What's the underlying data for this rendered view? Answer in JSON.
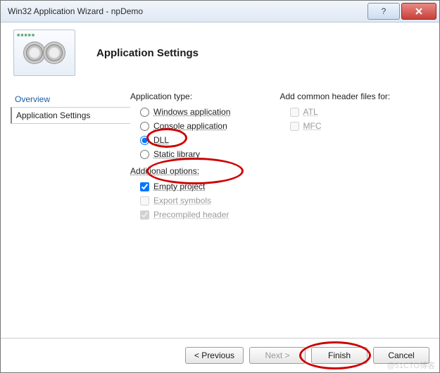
{
  "window": {
    "title": "Win32 Application Wizard - npDemo"
  },
  "header": {
    "title": "Application Settings"
  },
  "sidebar": {
    "items": [
      {
        "label": "Overview",
        "active": false
      },
      {
        "label": "Application Settings",
        "active": true
      }
    ]
  },
  "main": {
    "app_type_label": "Application type:",
    "app_type": [
      {
        "key": "windows",
        "label": "Windows application",
        "checked": false,
        "enabled": true
      },
      {
        "key": "console",
        "label": "Console application",
        "checked": false,
        "enabled": true
      },
      {
        "key": "dll",
        "label": "DLL",
        "checked": true,
        "enabled": true
      },
      {
        "key": "static",
        "label": "Static library",
        "checked": false,
        "enabled": true
      }
    ],
    "addl_label": "Additional options:",
    "addl": [
      {
        "key": "empty",
        "label": "Empty project",
        "checked": true,
        "enabled": true
      },
      {
        "key": "exports",
        "label": "Export symbols",
        "checked": false,
        "enabled": false
      },
      {
        "key": "pch",
        "label": "Precompiled header",
        "checked": true,
        "enabled": false
      }
    ],
    "headers_label": "Add common header files for:",
    "headers": [
      {
        "key": "atl",
        "label": "ATL",
        "checked": false,
        "enabled": false
      },
      {
        "key": "mfc",
        "label": "MFC",
        "checked": false,
        "enabled": false
      }
    ]
  },
  "footer": {
    "previous": "< Previous",
    "next": "Next >",
    "finish": "Finish",
    "cancel": "Cancel"
  },
  "watermark": "@51CTO博客"
}
